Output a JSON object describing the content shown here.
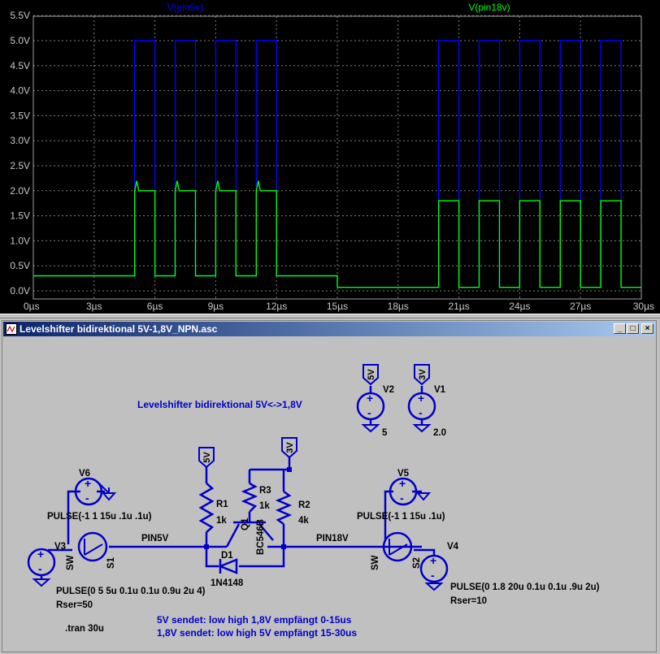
{
  "plot": {
    "trace_labels": [
      {
        "name": "V(pin5v)",
        "color": "#0000ff"
      },
      {
        "name": "V(pin18v)",
        "color": "#00ff00"
      }
    ],
    "y_ticks": [
      "0.0V",
      "0.5V",
      "1.0V",
      "1.5V",
      "2.0V",
      "2.5V",
      "3.0V",
      "3.5V",
      "4.0V",
      "4.5V",
      "5.0V",
      "5.5V"
    ],
    "x_ticks": [
      "0µs",
      "3µs",
      "6µs",
      "9µs",
      "12µs",
      "15µs",
      "18µs",
      "21µs",
      "24µs",
      "27µs",
      "30µs"
    ]
  },
  "chart_data": {
    "type": "line",
    "xlabel": "",
    "ylabel": "",
    "xlim": [
      0,
      30
    ],
    "ylim": [
      0,
      5.5
    ],
    "x_unit": "µs",
    "y_unit": "V",
    "grid": true,
    "series": [
      {
        "name": "V(pin5v)",
        "color": "#0000ff",
        "x": [
          0,
          5,
          5,
          6,
          6,
          7,
          7,
          8,
          8,
          9,
          9,
          10,
          10,
          11,
          11,
          12,
          12,
          15,
          15,
          20,
          20,
          21,
          21,
          22,
          22,
          23,
          23,
          24,
          24,
          25,
          25,
          26,
          26,
          27,
          27,
          28,
          28,
          29,
          29,
          30
        ],
        "y": [
          0.3,
          0.3,
          5.0,
          5.0,
          0.3,
          0.3,
          5.0,
          5.0,
          0.3,
          0.3,
          5.0,
          5.0,
          0.3,
          0.3,
          5.0,
          5.0,
          0.3,
          0.3,
          0.07,
          0.07,
          5.0,
          5.0,
          0.07,
          0.07,
          5.0,
          5.0,
          0.07,
          0.07,
          5.0,
          5.0,
          0.07,
          0.07,
          5.0,
          5.0,
          0.07,
          0.07,
          5.0,
          5.0,
          0.07,
          0.07
        ]
      },
      {
        "name": "V(pin18v)",
        "color": "#00ff00",
        "x": [
          0,
          5,
          5,
          5.1,
          5.2,
          6,
          6,
          7,
          7,
          7.1,
          7.2,
          8,
          8,
          9,
          9,
          9.1,
          9.2,
          10,
          10,
          11,
          11,
          11.1,
          11.2,
          12,
          12,
          15,
          15,
          20,
          20,
          21,
          21,
          22,
          22,
          23,
          23,
          24,
          24,
          25,
          25,
          26,
          26,
          27,
          27,
          28,
          28,
          29,
          29,
          30
        ],
        "y": [
          0.3,
          0.3,
          2.0,
          2.2,
          2.0,
          2.0,
          0.3,
          0.3,
          2.0,
          2.2,
          2.0,
          2.0,
          0.3,
          0.3,
          2.0,
          2.2,
          2.0,
          2.0,
          0.3,
          0.3,
          2.0,
          2.2,
          2.0,
          2.0,
          0.3,
          0.3,
          0.07,
          0.07,
          1.8,
          1.8,
          0.07,
          0.07,
          1.8,
          1.8,
          0.07,
          0.07,
          1.8,
          1.8,
          0.07,
          0.07,
          1.8,
          1.8,
          0.07,
          0.07,
          1.8,
          1.8,
          0.07,
          0.07
        ]
      }
    ]
  },
  "window": {
    "title": "Levelshifter bidirektional 5V-1,8V_NPN.asc",
    "btn_min": "_",
    "btn_max": "□",
    "btn_close": "×"
  },
  "schematic": {
    "title_comment": "Levelshifter bidirektional 5V<->1,8V",
    "flag_5v_a": "5V",
    "flag_3v_a": "3V",
    "flag_5v_b": "5V",
    "flag_3v_b": "3V",
    "v2": "V2",
    "v2_val": "5",
    "v1": "V1",
    "v1_val": "2.0",
    "v6": "V6",
    "v5": "V5",
    "v3": "V3",
    "v4": "V4",
    "pulse_v6": "PULSE(-1 1 15u .1u .1u)",
    "pulse_v5": "PULSE(-1 1 15u .1u)",
    "pulse_v3": "PULSE(0 5 5u 0.1u 0.1u 0.9u 2u 4)",
    "rser_v3": "Rser=50",
    "pulse_v4": "PULSE(0 1.8 20u 0.1u 0.1u .9u 2u)",
    "rser_v4": "Rser=10",
    "sw1": "SW",
    "s1": "S1",
    "sw2": "SW",
    "s2": "S2",
    "pin5v": "PIN5V",
    "pin18v": "PIN18V",
    "r1": "R1",
    "r1_val": "1k",
    "r3": "R3",
    "r3_val": "1k",
    "r2": "R2",
    "r2_val": "4k",
    "q1": "Q1",
    "q1_model": "BC546B",
    "d1": "D1",
    "d1_model": "1N4148",
    "tran": ".tran 30u",
    "note1": "5V sendet: low high 1,8V empfängt 0-15us",
    "note2": "1,8V sendet: low high 5V empfängt 15-30us"
  }
}
